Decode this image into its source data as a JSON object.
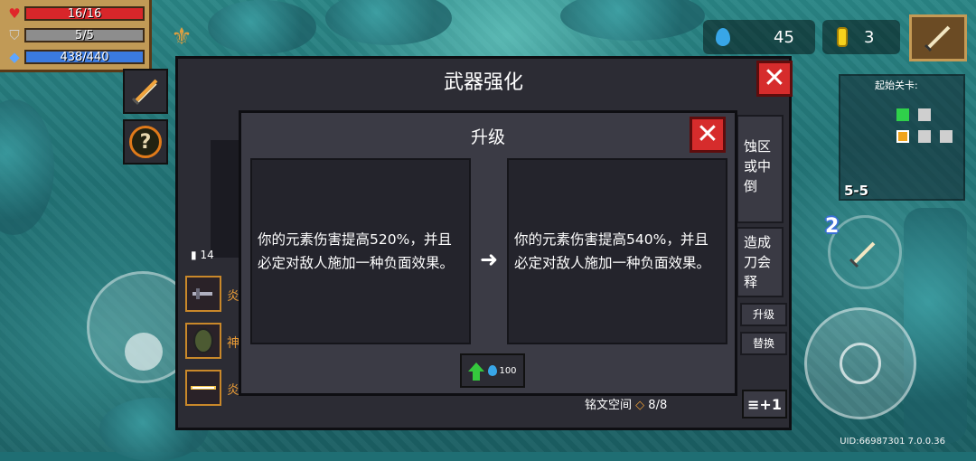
{
  "hud": {
    "hp": "16/16",
    "armor": "5/5",
    "energy": "438/440",
    "gems": "45",
    "coins": "3",
    "minimap_label": "起始关卡:",
    "stage": "5-5",
    "skill_charges": "2",
    "uid": "UID:66987301 7.0.0.36"
  },
  "panel": {
    "title": "武器强化",
    "ammo_stat": "14",
    "runes": [
      {
        "label": "炎"
      },
      {
        "label": "神"
      },
      {
        "label": "炎"
      }
    ],
    "side_cards": [
      "蚀区\n或中倒",
      "造成\n刀会释"
    ],
    "side_buttons": {
      "upgrade": "升级",
      "replace": "替换"
    },
    "rune_space_label": "铭文空间",
    "rune_space_value": "8/8",
    "add_button": "≡+1"
  },
  "dialog": {
    "title": "升级",
    "current_desc": "你的元素伤害提高520%，并且必定对敌人施加一种负面效果。",
    "next_desc": "你的元素伤害提高540%，并且必定对敌人施加一种负面效果。",
    "arrow": "➜",
    "cost": "100"
  },
  "colors": {
    "hp": "#d8262a",
    "armor": "#8d8d8d",
    "energy": "#3a7ae0",
    "close": "#d62c2c",
    "accent": "#e89b36"
  }
}
